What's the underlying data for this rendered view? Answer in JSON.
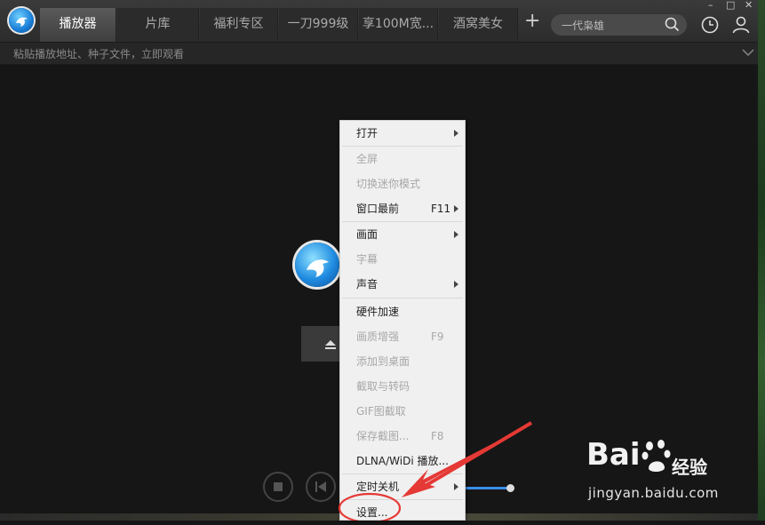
{
  "header": {
    "tabs": [
      {
        "label": "播放器",
        "active": true
      },
      {
        "label": "片库"
      },
      {
        "label": "福利专区"
      },
      {
        "label": "一刀999级"
      },
      {
        "label": "享100M宽..."
      },
      {
        "label": "酒窝美女"
      }
    ],
    "add_tab": "+",
    "search_placeholder": "一代枭雄",
    "window_min": "–",
    "window_max": "□",
    "window_close": "✕"
  },
  "urlbar": {
    "placeholder": "粘贴播放地址、种子文件，立即观看"
  },
  "menu": {
    "items": [
      {
        "label": "打开",
        "enabled": true,
        "submenu": true
      },
      {
        "label": "全屏",
        "enabled": false
      },
      {
        "label": "切换迷你模式",
        "enabled": false
      },
      {
        "label": "窗口最前",
        "enabled": true,
        "accel": "F11",
        "submenu": true
      },
      {
        "label": "画面",
        "enabled": true,
        "submenu": true
      },
      {
        "label": "字幕",
        "enabled": false
      },
      {
        "label": "声音",
        "enabled": true,
        "submenu": true
      },
      {
        "label": "硬件加速",
        "enabled": true
      },
      {
        "label": "画质增强",
        "enabled": false,
        "accel": "F9"
      },
      {
        "label": "添加到桌面",
        "enabled": false
      },
      {
        "label": "截取与转码",
        "enabled": false
      },
      {
        "label": "GIF图截取",
        "enabled": false
      },
      {
        "label": "保存截图...",
        "enabled": false,
        "accel": "F8"
      },
      {
        "label": "DLNA/WiDi 播放...",
        "enabled": true
      },
      {
        "label": "定时关机",
        "enabled": true,
        "submenu": true
      },
      {
        "label": "设置...",
        "enabled": true,
        "highlighted": true
      }
    ]
  },
  "player": {
    "volume_level": 1.0
  },
  "watermark": {
    "brand": "Bai",
    "brand_cn": "经验",
    "url": "jingyan.baidu.com"
  },
  "colors": {
    "accent": "#3a8ee8",
    "annotation": "#e53935"
  }
}
